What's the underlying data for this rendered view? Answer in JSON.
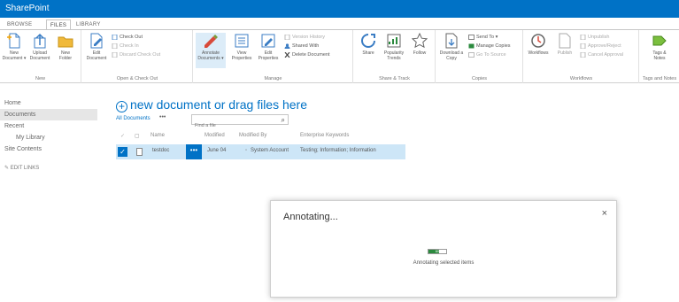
{
  "suite": {
    "brand": "SharePoint"
  },
  "tabs": [
    {
      "label": "BROWSE",
      "active": false
    },
    {
      "label": "FILES",
      "active": true
    },
    {
      "label": "LIBRARY",
      "active": false
    }
  ],
  "ribbon": {
    "new_group": {
      "label": "New",
      "new_document": "New\nDocument ▾",
      "upload_document": "Upload\nDocument",
      "new_folder": "New\nFolder"
    },
    "open_group": {
      "label": "Open & Check Out",
      "edit_document": "Edit\nDocument",
      "check_out": "Check Out",
      "check_in": "Check In",
      "discard_check_out": "Discard Check Out"
    },
    "manage_group": {
      "label": "Manage",
      "annotate_documents": "Annotate\nDocuments ▾",
      "view_properties": "View\nProperties",
      "edit_properties": "Edit\nProperties",
      "version_history": "Version History",
      "shared_with": "Shared With",
      "delete_document": "Delete Document"
    },
    "share_group": {
      "label": "Share & Track",
      "share": "Share",
      "popularity_trends": "Popularity\nTrends",
      "follow": "Follow"
    },
    "copies_group": {
      "label": "Copies",
      "download_copy": "Download a\nCopy",
      "send_to": "Send To ▾",
      "manage_copies": "Manage Copies",
      "go_to_source": "Go To Source"
    },
    "workflows_group": {
      "label": "Workflows",
      "workflows": "Workflows",
      "publish": "Publish",
      "unpublish": "Unpublish",
      "approve_reject": "Approve/Reject",
      "cancel_approval": "Cancel Approval"
    },
    "tags_group": {
      "label": "Tags and Notes",
      "tags_notes": "Tags &\nNotes"
    }
  },
  "nav": {
    "items": [
      "Home",
      "Documents",
      "Recent",
      "My Library",
      "Site Contents"
    ],
    "edit_links": "EDIT LINKS"
  },
  "main": {
    "new_document_text": "new document or drag files here",
    "view_name": "All Documents",
    "view_more": "•••",
    "find_placeholder": "Find a file",
    "columns": [
      "Name",
      "Modified",
      "Modified By",
      "Enterprise Keywords"
    ],
    "row": {
      "name": "testdoc",
      "more": "•••",
      "modified": "June 04",
      "modified_by": "System Account",
      "keywords": "Testing; Information; Information"
    }
  },
  "dialog": {
    "title": "Annotating...",
    "close": "×",
    "progress_value": 0.6,
    "progress_label": "60",
    "message": "Annotating selected items"
  },
  "colors": {
    "brand_blue": "#0072c6",
    "selected_row": "#cde6f7",
    "progress_green": "#2b8a3e"
  },
  "icons": {
    "new_document": "new-document-icon",
    "upload": "upload-icon",
    "folder": "folder-icon",
    "share": "share-icon",
    "follow": "star-icon",
    "search": "search-icon",
    "close": "close-icon"
  }
}
